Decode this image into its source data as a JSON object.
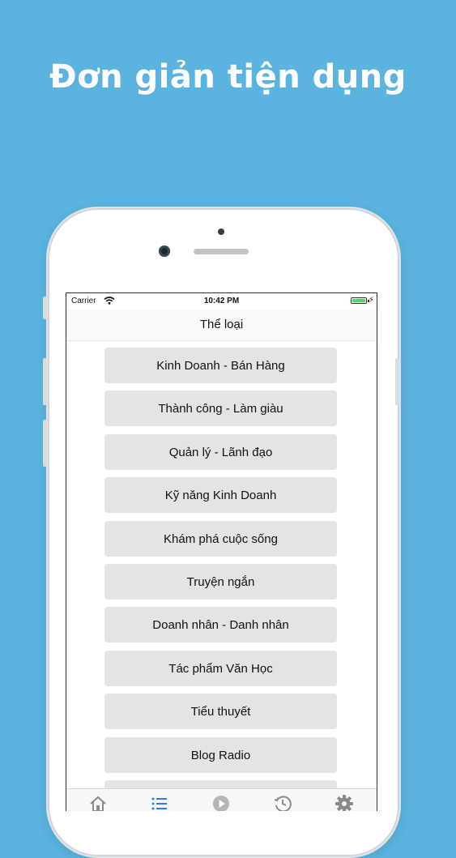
{
  "headline": "Đơn giản tiện dụng",
  "status_bar": {
    "carrier": "Carrier",
    "time": "10:42 PM",
    "battery_color": "#4cd964"
  },
  "navbar": {
    "title": "Thể loại"
  },
  "categories": [
    "Kinh Doanh - Bán Hàng",
    "Thành công - Làm giàu",
    "Quản lý - Lãnh đạo",
    "Kỹ năng Kinh Doanh",
    "Khám phá cuộc sống",
    "Truyện ngắn",
    "Doanh nhân - Danh nhân",
    "Tác phẩm Văn Học",
    "Tiểu thuyết",
    "Blog Radio"
  ],
  "tabbar": {
    "icons": [
      "home-icon",
      "list-icon",
      "play-icon",
      "history-icon",
      "gear-icon"
    ],
    "active_color": "#2f7bf6",
    "inactive_color": "#8a8a8a"
  },
  "colors": {
    "background": "#5ab4df",
    "button_bg": "#e4e3e6"
  }
}
